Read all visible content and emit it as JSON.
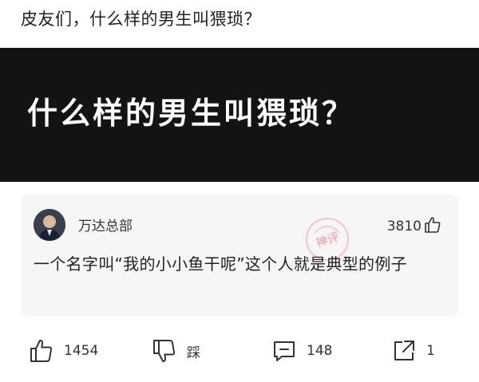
{
  "post": {
    "question": "皮友们，什么样的男生叫猥琐？",
    "banner_title": "什么样的男生叫猥琐？"
  },
  "god_comment": {
    "username": "万达总部",
    "likes": "3810",
    "text": "一个名字叫“我的小小鱼干呢”这个人就是典型的例子",
    "badge": "神评"
  },
  "actions": {
    "like_count": "1454",
    "dislike_label": "踩",
    "comment_count": "148",
    "share_count": "1"
  },
  "colors": {
    "banner_bg": "#131313",
    "card_bg": "#f6f6f6",
    "badge": "#f29aa6"
  }
}
